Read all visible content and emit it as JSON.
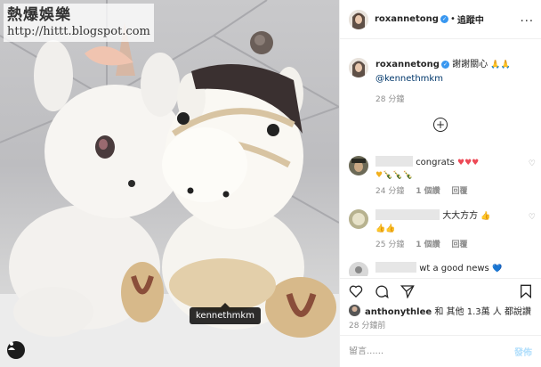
{
  "watermark": {
    "title": "熱爆娛樂",
    "url": "http://hittt.blogspot.com"
  },
  "photo": {
    "tag_username": "kennethmkm"
  },
  "header": {
    "username": "roxannetong",
    "separator": "•",
    "follow_label": "追蹤中",
    "more": "..."
  },
  "caption": {
    "username": "roxannetong",
    "text": "謝謝關心",
    "emoji": "🙏🙏",
    "mention": "@kennethmkm",
    "time": "28 分鐘"
  },
  "load_more_label": "+",
  "comments": [
    {
      "line1_text": "congrats",
      "line1_emoji": "♥♥♥",
      "line2_emoji": "♥🍾🍾🍾",
      "time": "24 分鐘",
      "likes": "1 個讚",
      "reply": "回覆"
    },
    {
      "text": "大大方方",
      "emoji": "👍",
      "line2_emoji": "👍👍",
      "time": "25 分鐘",
      "likes": "1 個讚",
      "reply": "回覆"
    },
    {
      "text": "wt a good news",
      "emoji": "💙"
    }
  ],
  "likes": {
    "username": "anthonythlee",
    "rest": "和 其他 1.3萬 人 都說讚"
  },
  "posted_time": "28 分鐘前",
  "composer": {
    "placeholder": "留言......",
    "post_label": "發佈"
  },
  "colors": {
    "verified": "#3897f0",
    "heart": "#ed4956",
    "post_disabled": "#b2dffc",
    "link": "#00376b"
  }
}
